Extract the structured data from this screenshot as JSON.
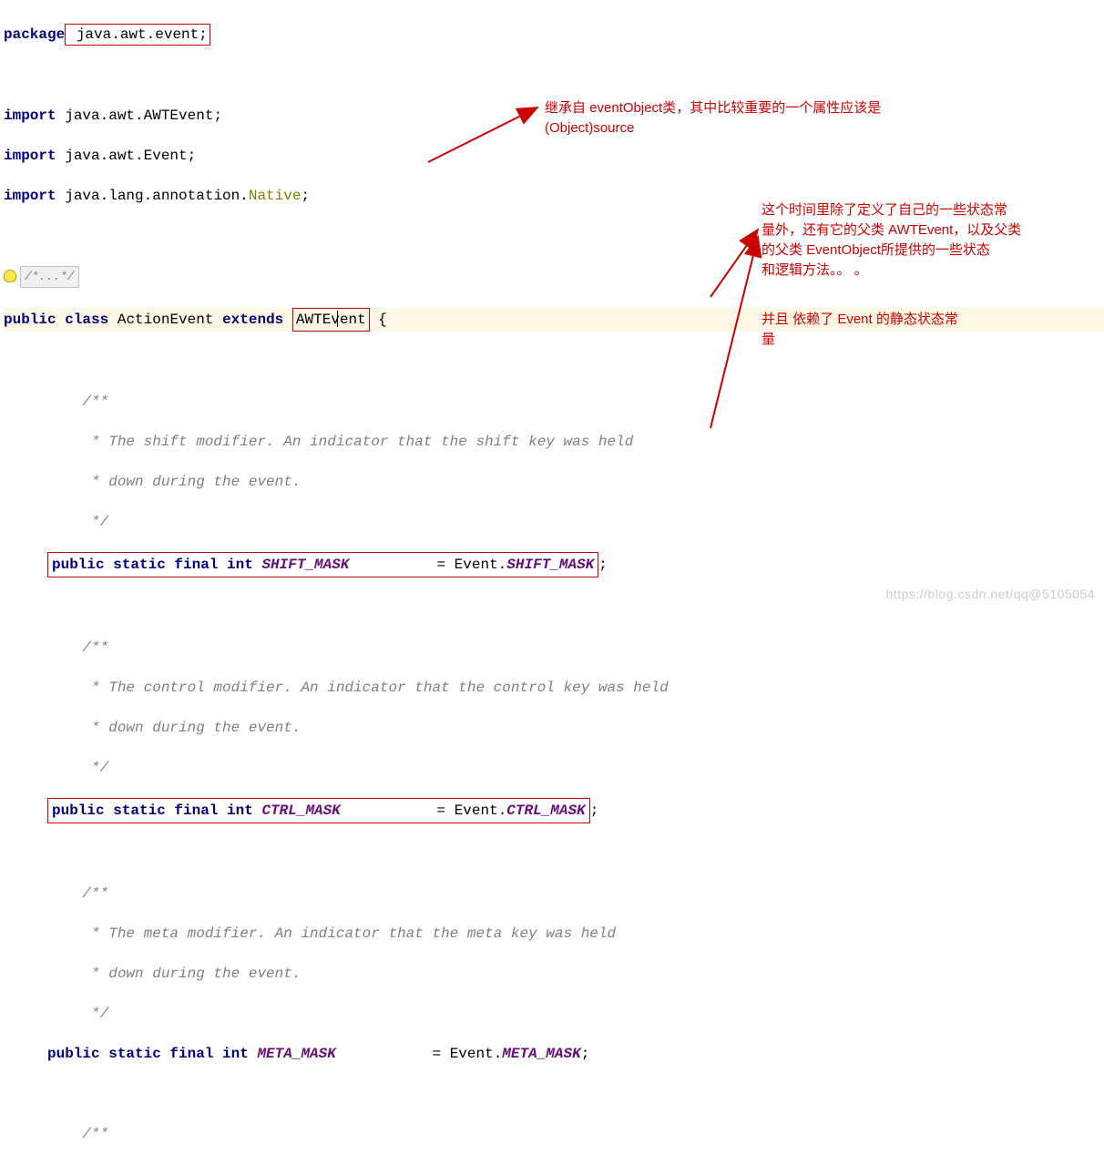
{
  "line1": {
    "kw": "package",
    "rest": " java.awt.event;"
  },
  "line3": {
    "kw": "import",
    "pkg": " java.awt.",
    "cls": "AWTEvent",
    "semi": ";"
  },
  "line4": {
    "kw": "import",
    "pkg": " java.awt.",
    "cls": "Event",
    "semi": ";"
  },
  "line5": {
    "kw": "import",
    "pkg": " java.lang.annotation.",
    "cls": "Native",
    "semi": ";"
  },
  "foldc": "/*...*/",
  "decl": {
    "pub": "public",
    "cls_kw": "class",
    "name": " ActionEvent ",
    "ext": "extends",
    "super": "AWTEvent",
    "brace": " {",
    "caret": "AWT|Event"
  },
  "c1a": "    /**",
  "c1b": "     * The shift modifier. An indicator that the shift key was held",
  "c1c": "     * down during the event.",
  "c1d": "     */",
  "f1": {
    "mods": "public static final int ",
    "name": "SHIFT_MASK",
    "pad": "          ",
    "eq": "= Event.",
    "ref": "SHIFT_MASK",
    "semi": ";"
  },
  "c2a": "    /**",
  "c2b": "     * The control modifier. An indicator that the control key was held",
  "c2c": "     * down during the event.",
  "c2d": "     */",
  "f2": {
    "mods": "public static final int ",
    "name": "CTRL_MASK",
    "pad": "           ",
    "eq": "= Event.",
    "ref": "CTRL_MASK",
    "semi": ";"
  },
  "c3a": "    /**",
  "c3b": "     * The meta modifier. An indicator that the meta key was held",
  "c3c": "     * down during the event.",
  "c3d": "     */",
  "f3": {
    "mods": "public static final int ",
    "name": "META_MASK",
    "pad": "           ",
    "eq": "= Event.",
    "ref": "META_MASK",
    "semi": ";"
  },
  "c4a": "    /**",
  "anno1a": "继承自   eventObject类，其中比较重要的一个属性应该是",
  "anno1b": "(Object)source",
  "anno2a": "这个时间里除了定义了自己的一些状态常",
  "anno2b": "量外，还有它的父类 AWTEvent，以及父类",
  "anno2c": "的父类 EventObject所提供的一些状态",
  "anno2d": "和逻辑方法。。 。",
  "anno3a": "    并且  依赖了   Event   的静态状态常",
  "anno3b": "量",
  "watermark": "https://blog.csdn.net/qq@5105054"
}
